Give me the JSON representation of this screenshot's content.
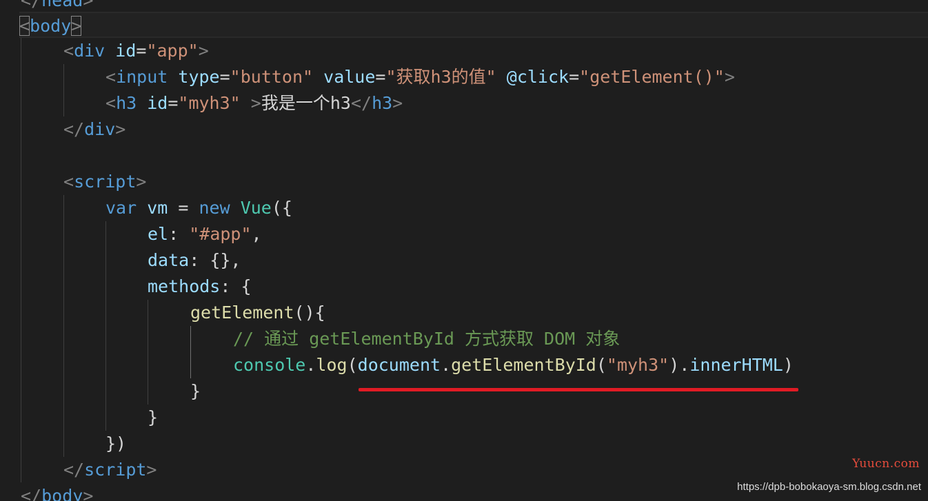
{
  "editor": {
    "lines": {
      "l00": {
        "open": "</",
        "tag": "head",
        "close": ">"
      },
      "l01": {
        "open": "<",
        "tag": "body",
        "close": ">"
      },
      "l02": {
        "open": "<",
        "tag": "div",
        "sp1": " ",
        "attr1": "id",
        "eq1": "=",
        "val1": "\"app\"",
        "close": ">"
      },
      "l03": {
        "open": "<",
        "tag": "input",
        "sp1": " ",
        "attr1": "type",
        "eq1": "=",
        "val1": "\"button\"",
        "sp2": " ",
        "attr2": "value",
        "eq2": "=",
        "val2": "\"获取h3的值\"",
        "sp3": " ",
        "attr3": "@click",
        "eq3": "=",
        "val3": "\"getElement()\"",
        "close": ">"
      },
      "l04": {
        "open": "<",
        "tag": "h3",
        "sp1": " ",
        "attr1": "id",
        "eq1": "=",
        "val1": "\"myh3\"",
        "sp2": " ",
        "close": ">",
        "text": "我是一个h3",
        "open2": "</",
        "tag2": "h3",
        "close2": ">"
      },
      "l05": {
        "open": "</",
        "tag": "div",
        "close": ">"
      },
      "l07": {
        "open": "<",
        "tag": "script",
        "close": ">"
      },
      "l08": {
        "kw1": "var",
        "sp1": " ",
        "var1": "vm",
        "op1": " = ",
        "kw2": "new",
        "sp2": " ",
        "cls": "Vue",
        "punc": "({"
      },
      "l09": {
        "key": "el",
        "colon": ": ",
        "str": "\"#app\"",
        "punc": ","
      },
      "l10": {
        "key": "data",
        "colon": ": ",
        "punc": "{},"
      },
      "l11": {
        "key": "methods",
        "colon": ": ",
        "punc": "{"
      },
      "l12": {
        "fn": "getElement",
        "punc": "(){"
      },
      "l13": {
        "comment": "// 通过 getElementById 方式获取 DOM 对象"
      },
      "l14": {
        "obj": "console",
        "dot1": ".",
        "fn1": "log",
        "p1": "(",
        "var1": "document",
        "dot2": ".",
        "fn2": "getElementById",
        "p2": "(",
        "str": "\"myh3\"",
        "p3": ")",
        "dot3": ".",
        "var2": "innerHTML",
        "p4": ")"
      },
      "l15": {
        "punc": "}"
      },
      "l16": {
        "punc": "}"
      },
      "l17": {
        "punc": "})"
      },
      "l18": {
        "open": "</",
        "tag": "script",
        "close": ">"
      },
      "l19": {
        "open": "</",
        "tag": "body",
        "close": ">"
      }
    }
  },
  "colors": {
    "background": "#1e1e1e",
    "tag": "#569cd6",
    "attribute": "#9cdcfe",
    "string": "#ce9178",
    "function": "#dcdcaa",
    "class": "#4ec9b0",
    "comment": "#6a9955",
    "bracket": "#808080",
    "highlight_underline": "#e01b24"
  },
  "watermark": {
    "brand": "Yuucn.com",
    "url": "https://dpb-bobokaoya-sm.blog.csdn.net"
  }
}
